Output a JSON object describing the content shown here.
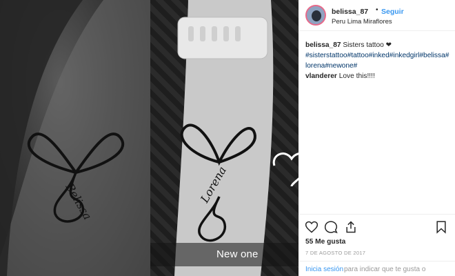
{
  "photo": {
    "overlay_caption": "New one",
    "tattoo_left_text": "Belissa",
    "tattoo_right_text": "Lorena"
  },
  "post_header": {
    "username": "belissa_87",
    "separator": "•",
    "follow_label": "Seguir",
    "location": "Peru Lima Miraflores"
  },
  "caption": {
    "username": "belissa_87",
    "text": " Sisters tattoo ❤",
    "hashtags": "#sisterstattoo#tattoo#inked#inkedgirl#belissa#lorena#newone#"
  },
  "comments": [
    {
      "username": "vlanderer",
      "text": " Love this!!!!"
    }
  ],
  "actions": {
    "icons": [
      "heart-icon",
      "comment-icon",
      "share-icon",
      "bookmark-icon"
    ]
  },
  "stats": {
    "likes": "55 Me gusta",
    "date": "7 DE AGOSTO DE 2017"
  },
  "footer": {
    "login_label": "Inicia sesión",
    "login_suffix": "para indicar que te gusta o"
  },
  "colors": {
    "link_blue": "#3897f0",
    "hashtag_blue": "#003569",
    "text": "#262626",
    "muted": "#999999"
  }
}
